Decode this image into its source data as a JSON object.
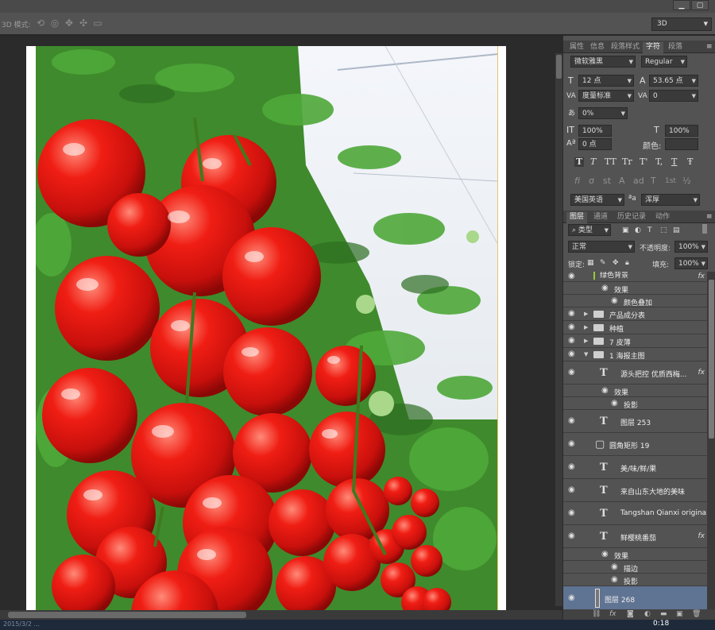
{
  "options_bar": {
    "mode3d_label": "3D 模式:",
    "workspace": "3D"
  },
  "window": {
    "min": "▁",
    "max": "▢"
  },
  "character_panel": {
    "tabs": [
      "属性",
      "信息",
      "段落样式",
      "字符",
      "段落"
    ],
    "active_tab": "字符",
    "font_family": "微软雅黑",
    "font_style": "Regular",
    "font_size": "12 点",
    "leading": "53.65 点",
    "kerning": "度量标准",
    "tracking": "0",
    "tsume": "0%",
    "vertical_scale": "100%",
    "horizontal_scale": "100%",
    "baseline_shift": "0 点",
    "color_label": "颜色:",
    "color_value": "#3a3a3a",
    "language": "美国英语",
    "aa_label": "ªa",
    "antialias": "浑厚",
    "style_buttons": [
      "T",
      "T",
      "TT",
      "Tr",
      "T'",
      "T,",
      "T",
      "Ŧ"
    ],
    "opentype_buttons": [
      "fi",
      "ơ",
      "st",
      "A",
      "ad",
      "T",
      "1st",
      "½"
    ]
  },
  "layers_panel": {
    "tabs": [
      "图层",
      "通道",
      "历史记录",
      "动作"
    ],
    "active_tab": "图层",
    "filter_kind": "类型",
    "blend_mode": "正常",
    "opacity_label": "不透明度:",
    "opacity": "100%",
    "lock_label": "锁定:",
    "fill_label": "填充:",
    "fill": "100%",
    "rows": [
      {
        "kind": "partial",
        "name": "绿色背景",
        "fx": "fx"
      },
      {
        "kind": "effects",
        "name": "效果"
      },
      {
        "kind": "effect",
        "name": "颜色叠加"
      },
      {
        "kind": "group",
        "name": "产品成分表"
      },
      {
        "kind": "group",
        "name": "种植"
      },
      {
        "kind": "group",
        "name": "7 皮薄"
      },
      {
        "kind": "group-open",
        "name": "1 海报主图"
      },
      {
        "kind": "text",
        "name": "源头把控 优质西梅...",
        "fx": "fx"
      },
      {
        "kind": "effects",
        "name": "效果"
      },
      {
        "kind": "effect",
        "name": "投影"
      },
      {
        "kind": "text",
        "name": "图层 253"
      },
      {
        "kind": "shape",
        "name": "圆角矩形 19"
      },
      {
        "kind": "text",
        "name": "美/味/鲜/果"
      },
      {
        "kind": "text",
        "name": "来自山东大地的美味"
      },
      {
        "kind": "text",
        "name": "Tangshan Qianxi origina..."
      },
      {
        "kind": "text",
        "name": "鲜樱桃番茄",
        "fx": "fx"
      },
      {
        "kind": "effects",
        "name": "效果"
      },
      {
        "kind": "effect",
        "name": "描边"
      },
      {
        "kind": "effect",
        "name": "投影"
      },
      {
        "kind": "pixel",
        "name": "图层 268",
        "selected": true
      }
    ]
  },
  "taskbar": {
    "clock": "0:18",
    "left_text": "2015/3/2 ..."
  }
}
